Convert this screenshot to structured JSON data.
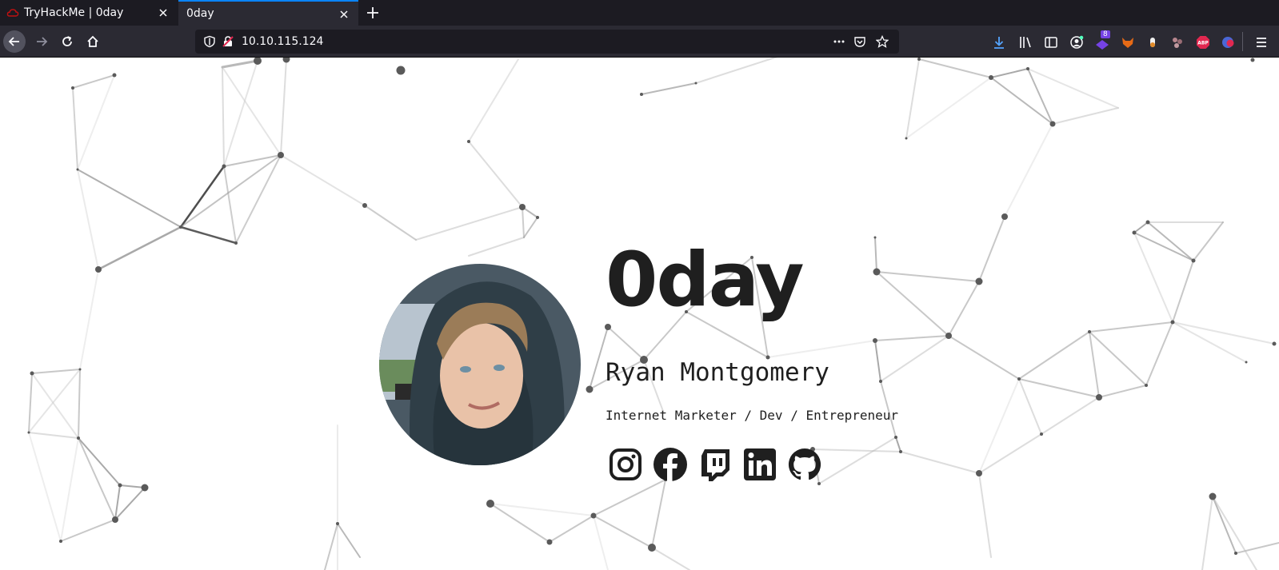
{
  "browser": {
    "tabs": [
      {
        "title": "TryHackMe | 0day",
        "active": false
      },
      {
        "title": "0day",
        "active": true
      }
    ],
    "url": "10.10.115.124",
    "extension_badge": "8"
  },
  "profile": {
    "handle": "0day",
    "name": "Ryan Montgomery",
    "tagline": "Internet Marketer / Dev / Entrepreneur",
    "avatar_icon": "profile-photo",
    "socials": [
      {
        "icon": "instagram-icon"
      },
      {
        "icon": "facebook-icon"
      },
      {
        "icon": "twitch-icon"
      },
      {
        "icon": "linkedin-icon"
      },
      {
        "icon": "github-icon"
      }
    ]
  },
  "colors": {
    "accent": "#0a84ff",
    "text": "#1f1f1f",
    "chrome": "#2b2a33",
    "tabbar": "#1c1b22"
  }
}
